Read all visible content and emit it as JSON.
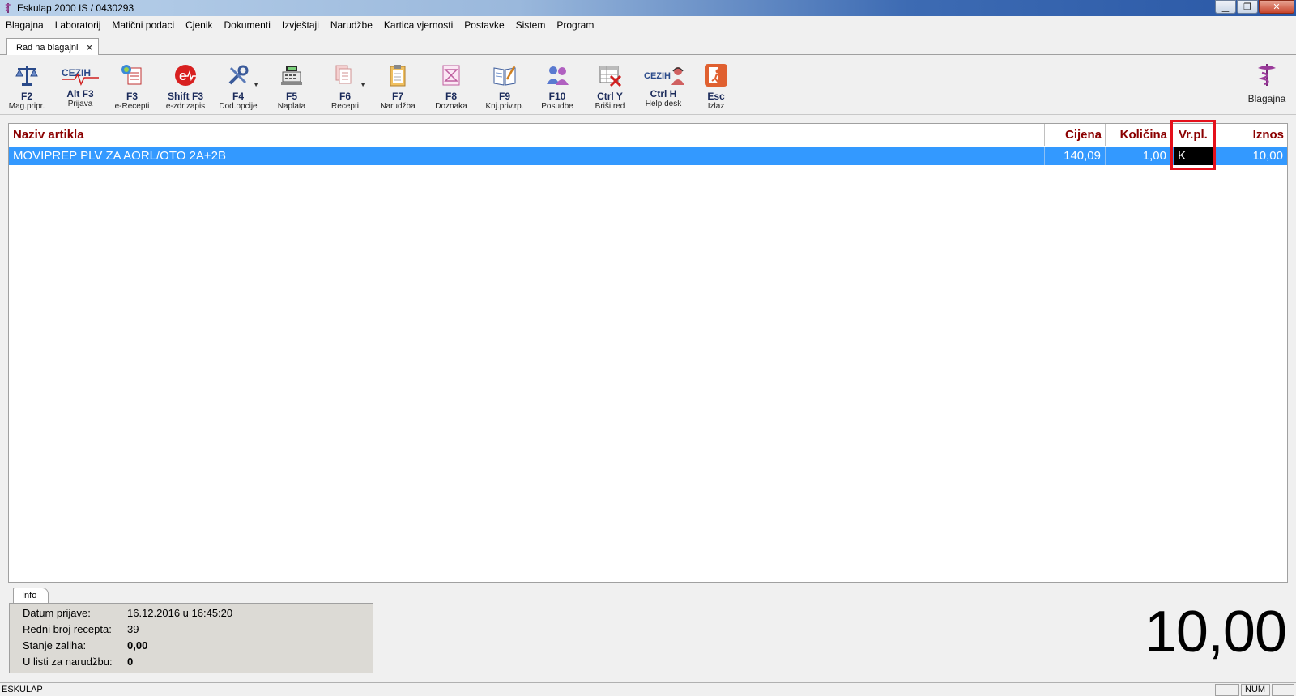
{
  "window": {
    "title": "Eskulap 2000  IS / 0430293"
  },
  "menu": [
    "Blagajna",
    "Laboratorij",
    "Matični podaci",
    "Cjenik",
    "Dokumenti",
    "Izvještaji",
    "Narudžbe",
    "Kartica vjernosti",
    "Postavke",
    "Sistem",
    "Program"
  ],
  "doc_tab": {
    "label": "Rad na blagajni"
  },
  "toolbar": [
    {
      "key": "F2",
      "label": "Mag.pripr.",
      "icon": "scales-icon"
    },
    {
      "key": "Alt F3",
      "label": "Prijava",
      "icon": "cezih-icon"
    },
    {
      "key": "F3",
      "label": "e-Recepti",
      "icon": "e-recept-icon"
    },
    {
      "key": "Shift F3",
      "label": "e-zdr.zapis",
      "icon": "e-health-icon"
    },
    {
      "key": "F4",
      "label": "Dod.opcije",
      "icon": "tools-icon"
    },
    {
      "key": "F5",
      "label": "Naplata",
      "icon": "cash-register-icon"
    },
    {
      "key": "F6",
      "label": "Recepti",
      "icon": "documents-icon"
    },
    {
      "key": "F7",
      "label": "Narudžba",
      "icon": "clipboard-icon"
    },
    {
      "key": "F8",
      "label": "Doznaka",
      "icon": "voucher-icon"
    },
    {
      "key": "F9",
      "label": "Knj.priv.rp.",
      "icon": "book-icon"
    },
    {
      "key": "F10",
      "label": "Posudbe",
      "icon": "people-icon"
    },
    {
      "key": "Ctrl Y",
      "label": "Briši red",
      "icon": "delete-row-icon"
    },
    {
      "key": "Ctrl H",
      "label": "Help desk",
      "icon": "helpdesk-icon"
    },
    {
      "key": "Esc",
      "label": "Izlaz",
      "icon": "exit-icon"
    }
  ],
  "cezih_text": "CEZIH",
  "blagajna_label": "Blagajna",
  "grid": {
    "headers": {
      "name": "Naziv artikla",
      "price": "Cijena",
      "qty": "Količina",
      "type": "Vr.pl.",
      "amount": "Iznos"
    },
    "rows": [
      {
        "name": "MOVIPREP PLV ZA AORL/OTO 2A+2B",
        "price": "140,09",
        "qty": "1,00",
        "type": "K",
        "amount": "10,00"
      }
    ]
  },
  "info": {
    "tab": "Info",
    "rows": [
      {
        "label": "Datum prijave:",
        "value": "16.12.2016 u 16:45:20"
      },
      {
        "label": "Redni broj recepta:",
        "value": "39"
      },
      {
        "label": "Stanje zaliha:",
        "value": "0,00"
      },
      {
        "label": "U listi za narudžbu:",
        "value": "0"
      }
    ]
  },
  "total": "10,00",
  "status": {
    "text": "ESKULAP",
    "num": "NUM"
  },
  "colors": {
    "header_text": "#8b0000",
    "selected_row": "#3399ff",
    "highlight": "#e4101b"
  }
}
